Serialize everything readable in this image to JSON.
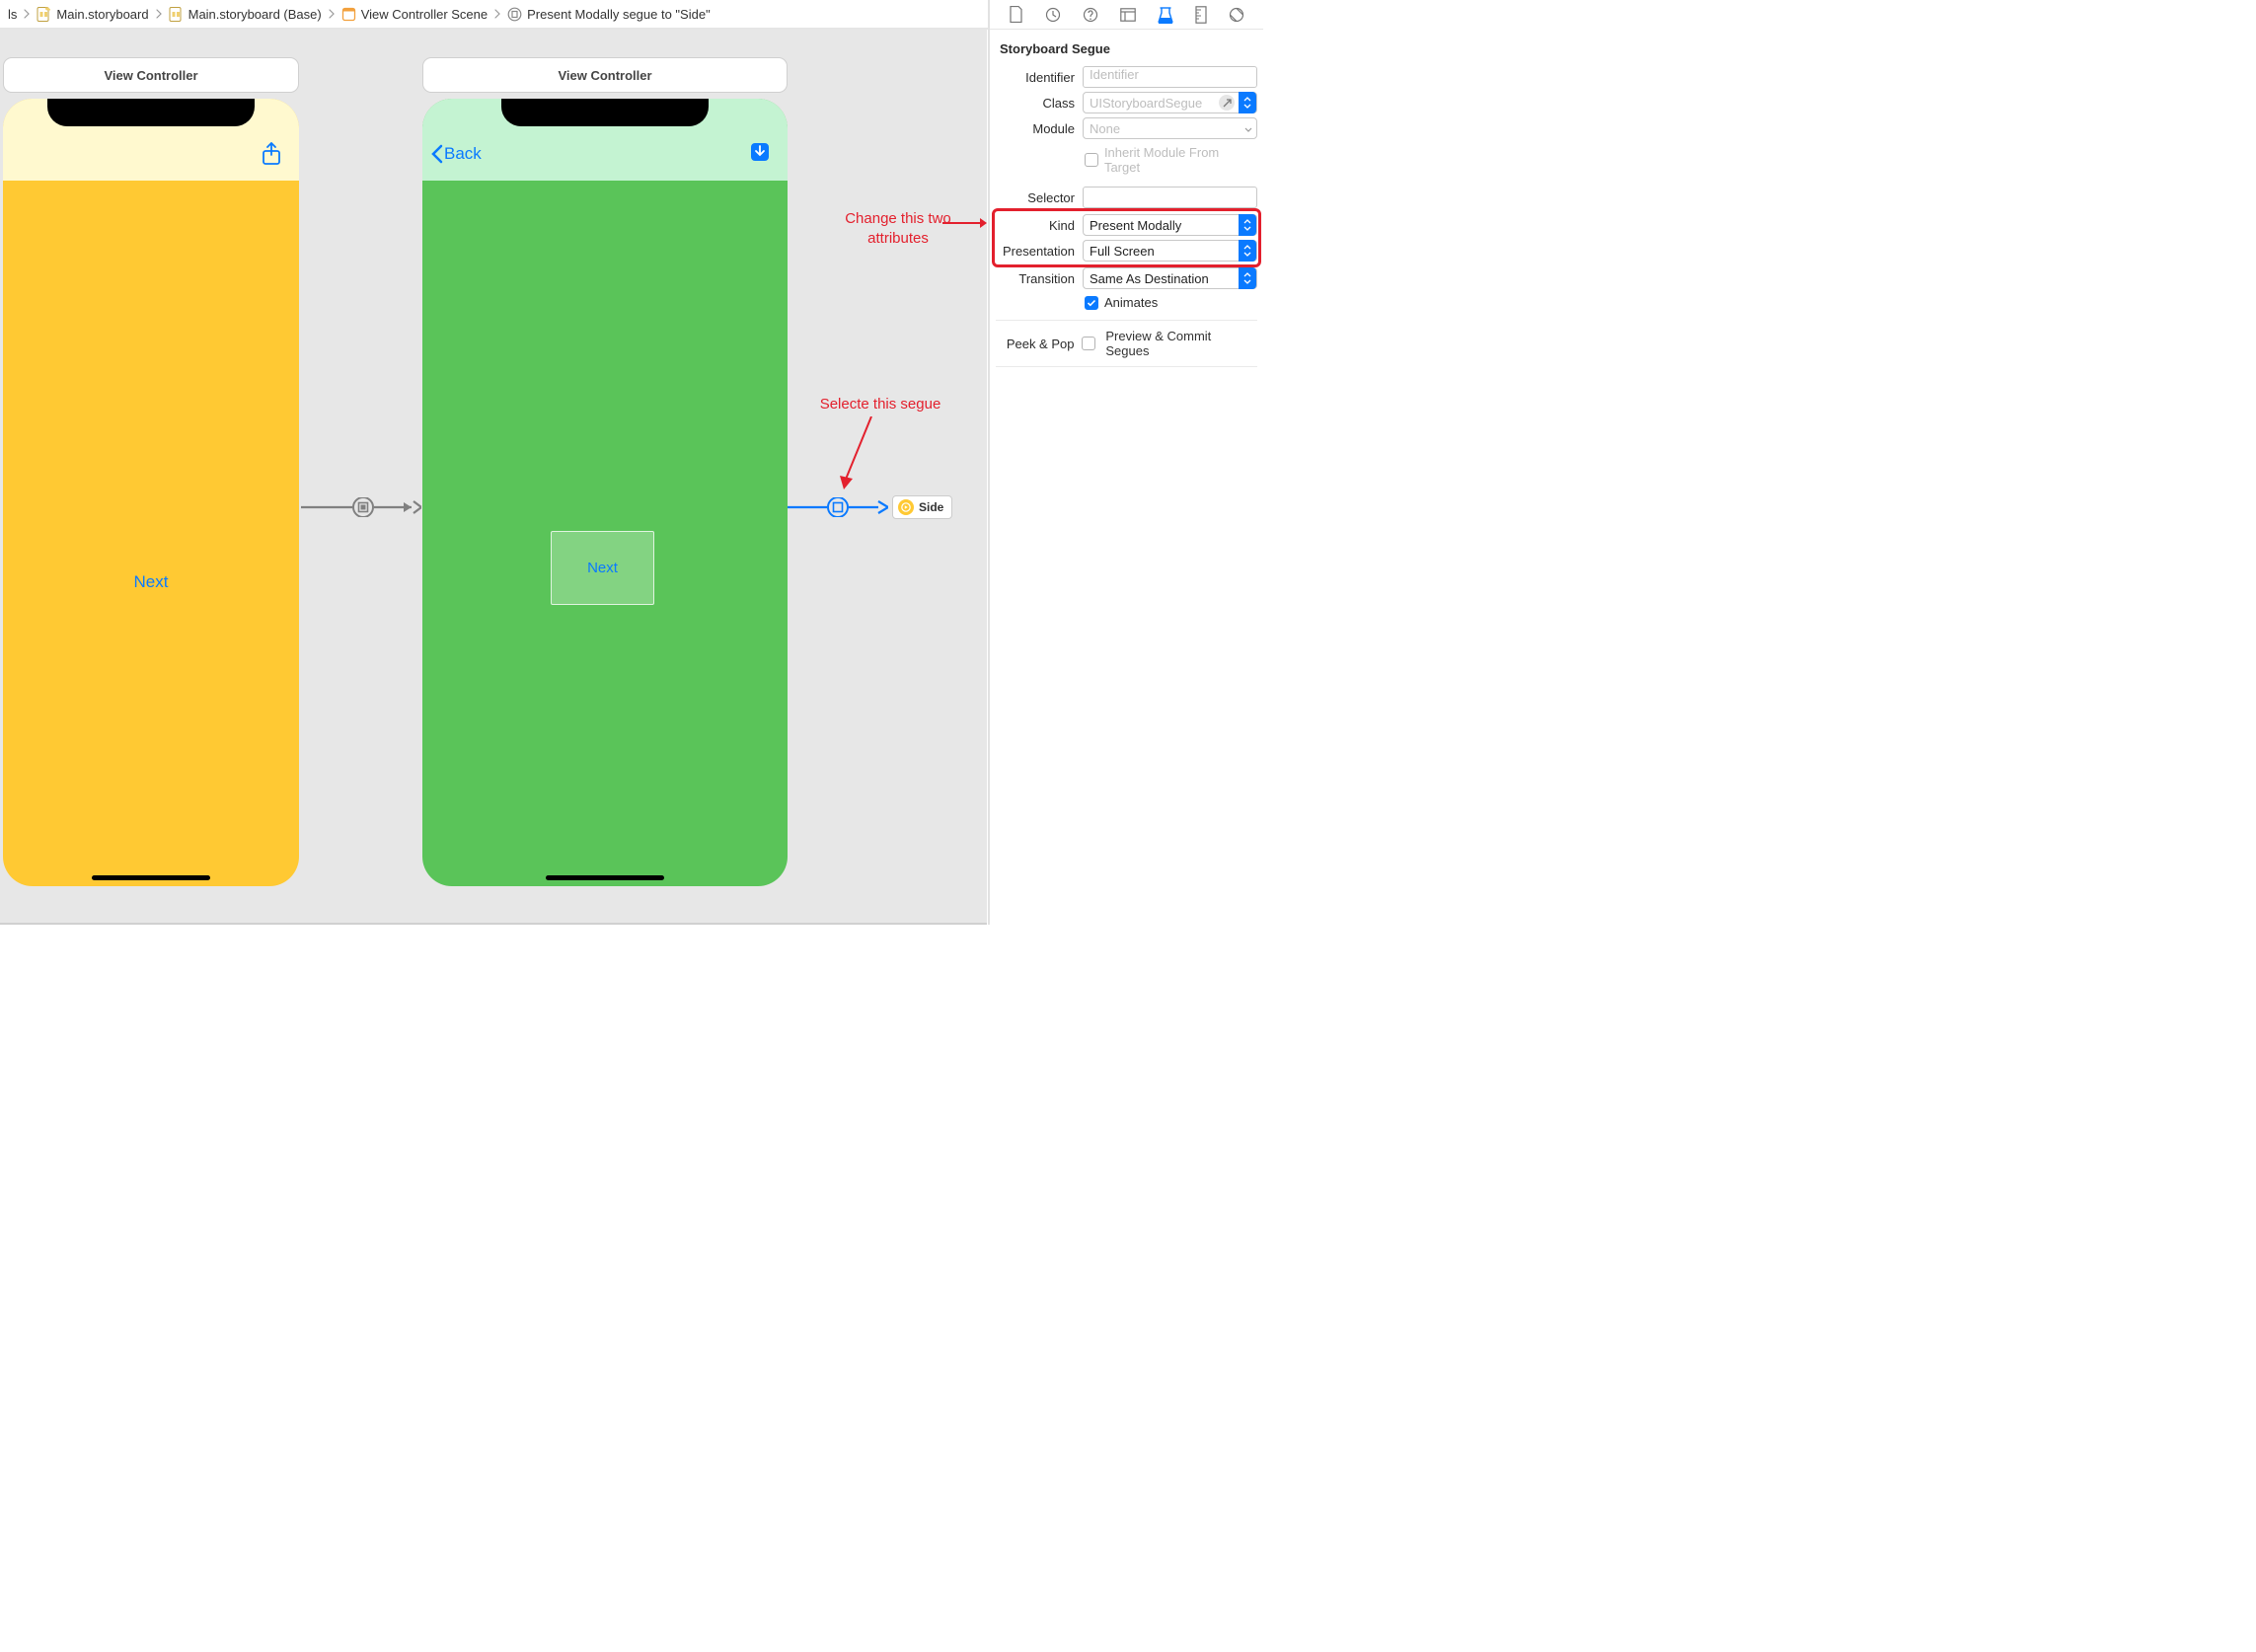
{
  "breadcrumbs": {
    "item0": "ls",
    "item1": "Main.storyboard",
    "item2": "Main.storyboard (Base)",
    "item3": "View Controller Scene",
    "item4": "Present Modally segue to \"Side\""
  },
  "scene1": {
    "title": "View Controller",
    "button": "Next"
  },
  "scene2": {
    "title": "View Controller",
    "back": "Back",
    "container_button": "Next"
  },
  "side_badge": {
    "label": "Side"
  },
  "annotations": {
    "attrs_line1": "Change this two",
    "attrs_line2": "attributes",
    "segue": "Selecte this segue"
  },
  "inspector": {
    "section": "Storyboard Segue",
    "labels": {
      "identifier": "Identifier",
      "classL": "Class",
      "moduleL": "Module",
      "inherit": "Inherit Module From Target",
      "selectorL": "Selector",
      "kindL": "Kind",
      "presentationL": "Presentation",
      "transitionL": "Transition",
      "animates": "Animates",
      "peekPopL": "Peek & Pop",
      "peekPopVal": "Preview & Commit Segues"
    },
    "values": {
      "identifier_placeholder": "Identifier",
      "classV": "UIStoryboardSegue",
      "moduleV": "None",
      "selectorV": "",
      "kind": "Present Modally",
      "presentation": "Full Screen",
      "transition": "Same As Destination"
    }
  }
}
